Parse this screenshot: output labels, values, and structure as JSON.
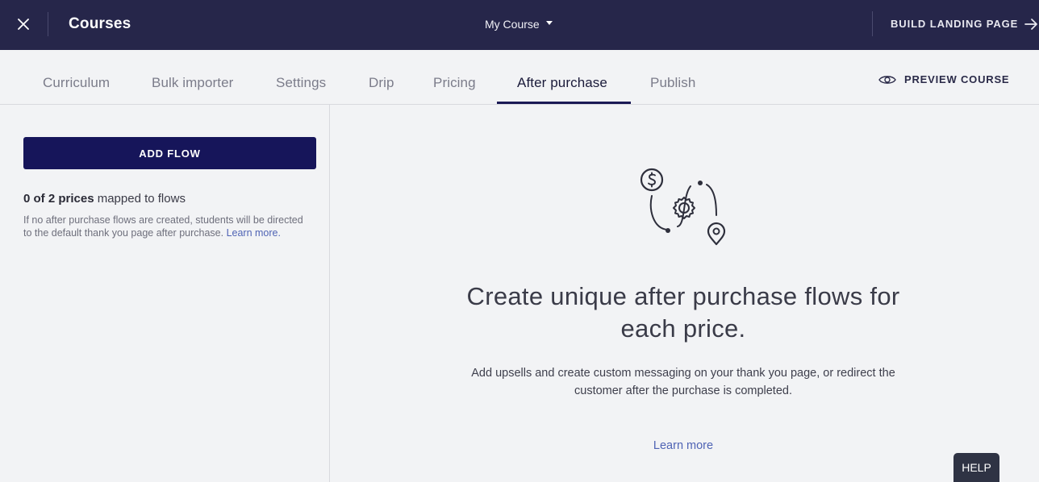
{
  "topbar": {
    "close_icon": "close-icon",
    "title": "Courses",
    "course_selector": "My Course",
    "build_landing_page": "BUILD LANDING PAGE",
    "background_color": "#26264a"
  },
  "tabs": [
    {
      "label": "Curriculum",
      "active": false
    },
    {
      "label": "Bulk importer",
      "active": false
    },
    {
      "label": "Settings",
      "active": false
    },
    {
      "label": "Drip",
      "active": false
    },
    {
      "label": "Pricing",
      "active": false
    },
    {
      "label": "After purchase",
      "active": true
    },
    {
      "label": "Publish",
      "active": false
    }
  ],
  "preview": {
    "label": "PREVIEW COURSE",
    "icon": "eye-icon"
  },
  "sidebar": {
    "add_flow_label": "ADD FLOW",
    "mapped_count": "0 of 2 prices",
    "mapped_suffix": " mapped to flows",
    "note": "If no after purchase flows are created, students will be directed to the default thank you page after purchase. ",
    "learn_more": "Learn more."
  },
  "main": {
    "headline": "Create unique after purchase flows for each price.",
    "subtext": "Add upsells and create custom messaging on your thank you page, or redirect the customer after the purchase is completed.",
    "learn_more": "Learn more"
  },
  "help_label": "HELP",
  "colors": {
    "accent": "#16155a",
    "link": "#4f63b4",
    "active_tab_underline": "#1b1a55"
  }
}
